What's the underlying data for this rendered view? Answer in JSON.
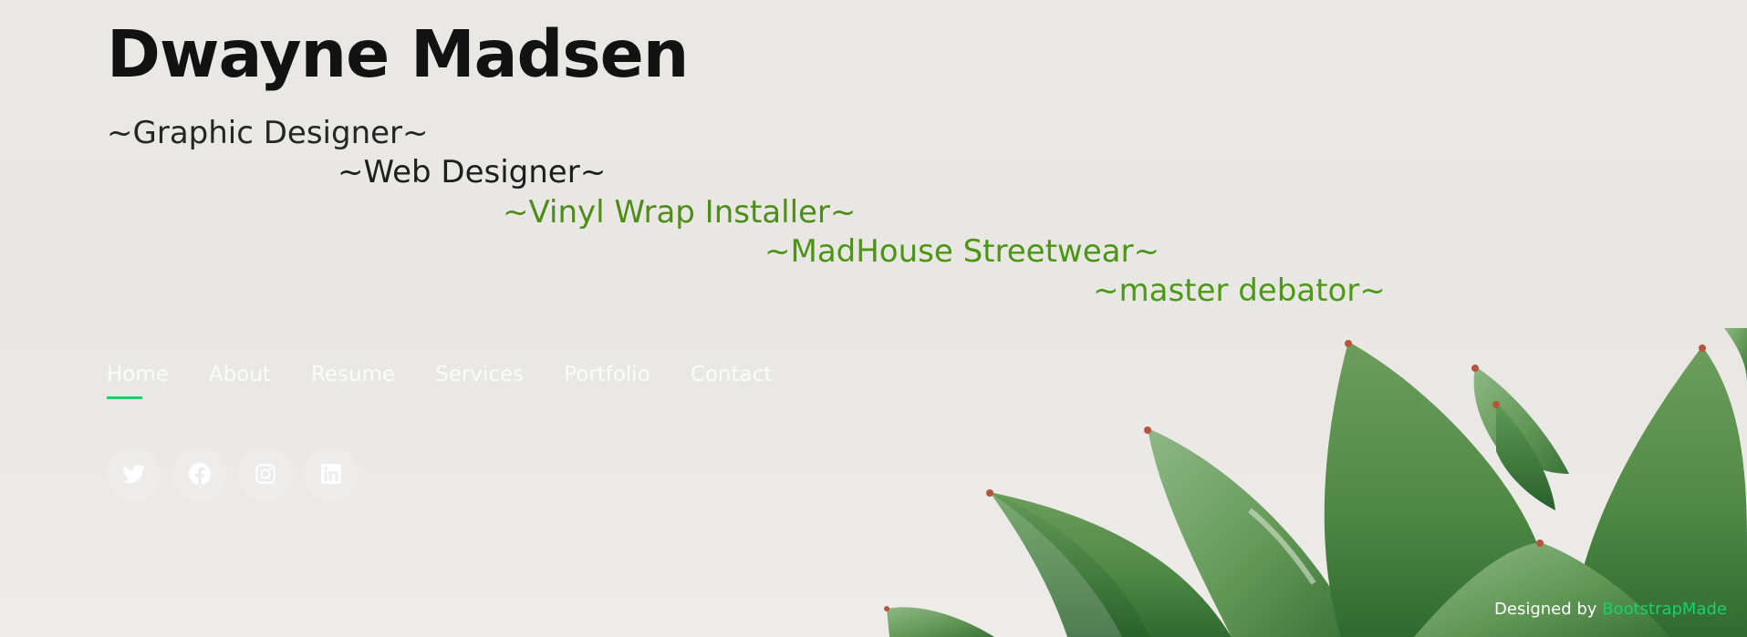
{
  "header": {
    "name": "Dwayne Madsen",
    "roles": [
      "~Graphic Designer~",
      "~Web Designer~",
      "~Vinyl Wrap Installer~",
      "~MadHouse Streetwear~",
      "~master debator~"
    ]
  },
  "nav": {
    "items": [
      {
        "label": "Home",
        "active": true
      },
      {
        "label": "About",
        "active": false
      },
      {
        "label": "Resume",
        "active": false
      },
      {
        "label": "Services",
        "active": false
      },
      {
        "label": "Portfolio",
        "active": false
      },
      {
        "label": "Contact",
        "active": false
      }
    ]
  },
  "social": {
    "links": [
      {
        "icon": "twitter-icon"
      },
      {
        "icon": "facebook-icon"
      },
      {
        "icon": "instagram-icon"
      },
      {
        "icon": "linkedin-icon"
      }
    ]
  },
  "footer": {
    "credits_prefix": "Designed by",
    "credits_link": "BootstrapMade"
  },
  "colors": {
    "accent": "#18d26e",
    "role_green": "#4c9a14",
    "heading": "#121212"
  }
}
